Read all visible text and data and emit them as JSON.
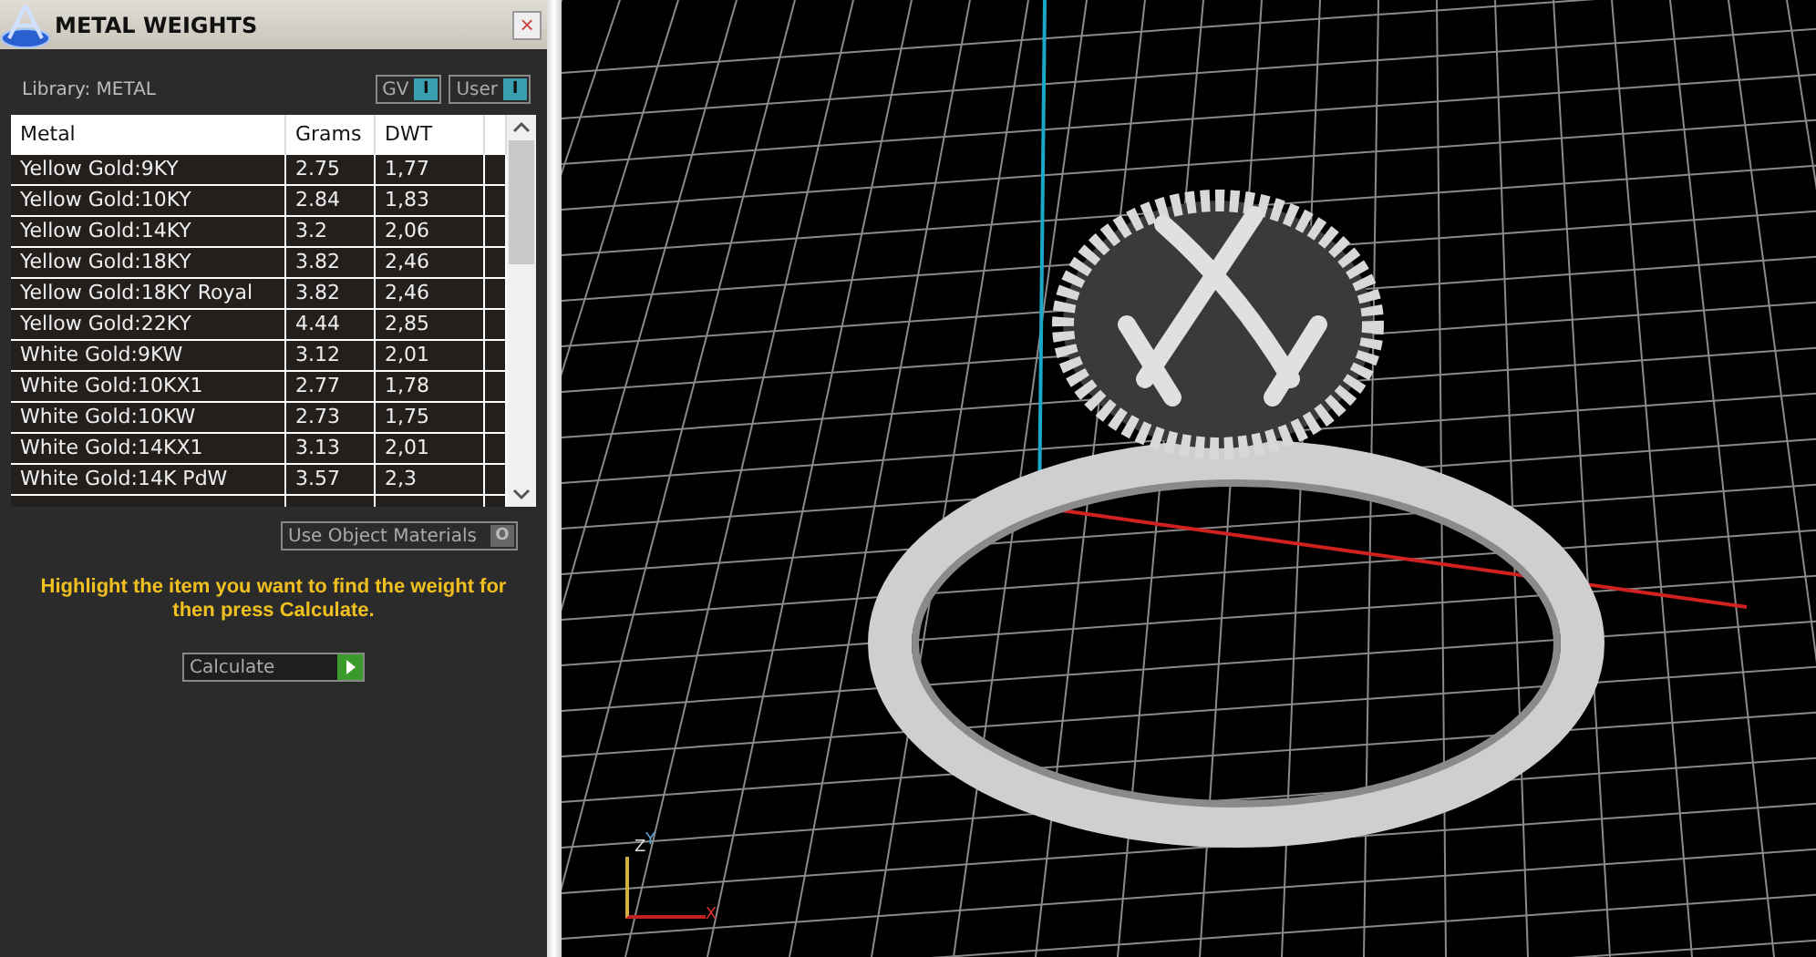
{
  "panel": {
    "title": "METAL WEIGHTS",
    "close": "×",
    "library_label": "Library: METAL",
    "toggles": [
      {
        "label": "GV",
        "glyph": "I",
        "on": true
      },
      {
        "label": "User",
        "glyph": "I",
        "on": true
      }
    ],
    "table": {
      "columns": [
        "Metal",
        "Grams",
        "DWT"
      ],
      "rows": [
        [
          "Yellow Gold:9KY",
          "2.75",
          "1,77"
        ],
        [
          "Yellow Gold:10KY",
          "2.84",
          "1,83"
        ],
        [
          "Yellow Gold:14KY",
          "3.2",
          "2,06"
        ],
        [
          "Yellow Gold:18KY",
          "3.82",
          "2,46"
        ],
        [
          "Yellow Gold:18KY Royal",
          "3.82",
          "2,46"
        ],
        [
          "Yellow Gold:22KY",
          "4.44",
          "2,85"
        ],
        [
          "White Gold:9KW",
          "3.12",
          "2,01"
        ],
        [
          "White Gold:10KX1",
          "2.77",
          "1,78"
        ],
        [
          "White Gold:10KW",
          "2.73",
          "1,75"
        ],
        [
          "White Gold:14KX1",
          "3.13",
          "2,01"
        ],
        [
          "White Gold:14K PdW",
          "3.57",
          "2,3"
        ]
      ]
    },
    "object_materials": {
      "label": "Use Object Materials",
      "glyph": "O",
      "on": false
    },
    "hint": "Highlight the item you want to find the weight for then press Calculate.",
    "calculate": "Calculate"
  },
  "viewport": {
    "axes": [
      {
        "label": "Z"
      },
      {
        "label": "Y"
      },
      {
        "label": "X"
      }
    ]
  }
}
